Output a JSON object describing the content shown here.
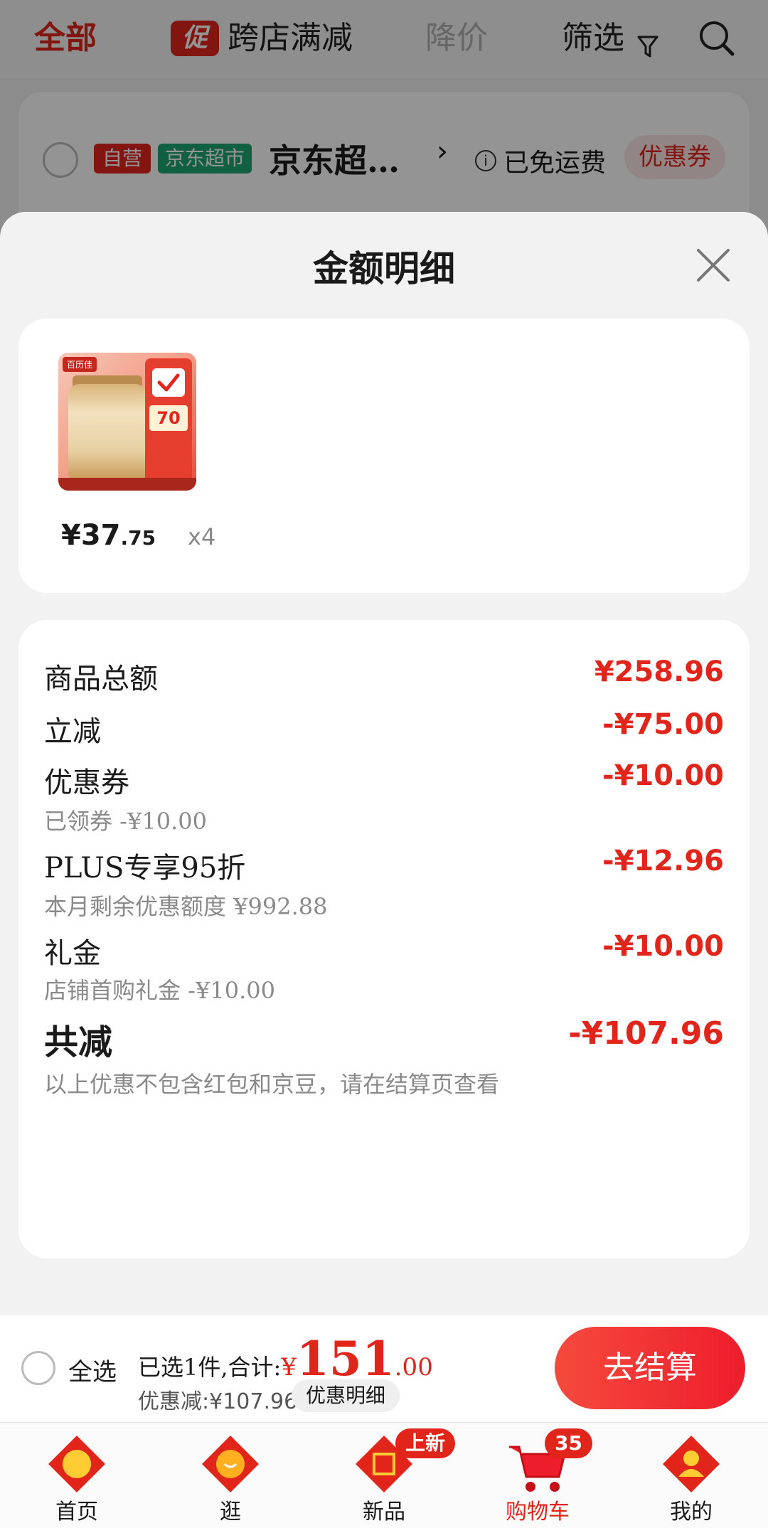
{
  "filter_bar": {
    "tab_all": "全部",
    "promo_icon": "促",
    "tab_cross_store": "跨店满减",
    "tab_price_drop": "降价",
    "tab_filter": "筛选"
  },
  "shop": {
    "badge_self": "自营",
    "badge_supermarket": "京东超市",
    "name": "京东超…",
    "free_shipping": "已免运费",
    "coupon": "优惠券"
  },
  "sheet": {
    "title": "金额明细",
    "product": {
      "price_int": "¥37",
      "price_dec": ".75",
      "quantity": "x4",
      "thumb_brand": "百历佳",
      "thumb_price": "70"
    },
    "rows": {
      "subtotal_label": "商品总额",
      "subtotal_value": "¥258.96",
      "instant_label": "立减",
      "instant_value": "-¥75.00",
      "coupon_label": "优惠券",
      "coupon_sub": "已领券 -¥10.00",
      "coupon_value": "-¥10.00",
      "plus_label": "PLUS专享95折",
      "plus_sub": "本月剩余优惠额度 ¥992.88",
      "plus_value": "-¥12.96",
      "gift_label": "礼金",
      "gift_sub": "店铺首购礼金 -¥10.00",
      "gift_value": "-¥10.00",
      "total_label": "共减",
      "total_value": "-¥107.96",
      "note": "以上优惠不包含红包和京豆，请在结算页查看"
    }
  },
  "checkout": {
    "select_all": "全选",
    "selected_text": "已选1件,合计:",
    "sum_symbol": "¥",
    "sum_int": "151",
    "sum_dec": ".00",
    "discount_text": "优惠减:¥107.96",
    "detail_button": "优惠明细",
    "pay_button": "去结算"
  },
  "tabbar": {
    "home": "首页",
    "browse": "逛",
    "new": "新品",
    "new_badge": "上新",
    "cart": "购物车",
    "cart_badge": "35",
    "me": "我的"
  },
  "colors": {
    "brand_red": "#e1251b",
    "jd_green": "#1ea672"
  }
}
